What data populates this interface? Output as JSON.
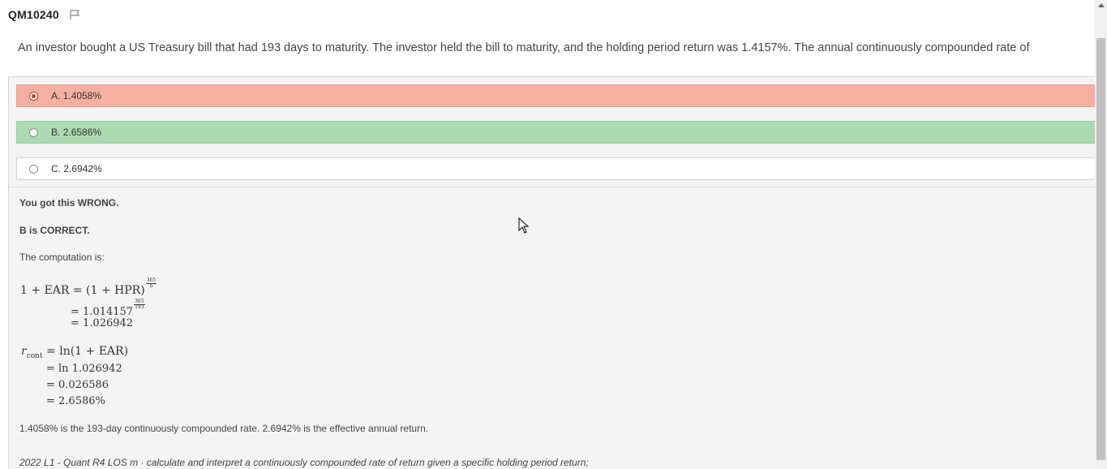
{
  "question_id": "QM10240",
  "question_text": "An investor bought a US Treasury bill that had 193 days to maturity.  The investor held the bill to maturity, and the holding period return was 1.4157%.  The annual continuously compounded rate of",
  "options": [
    {
      "letter": "A.",
      "value": "1.4058%",
      "state": "selected-wrong"
    },
    {
      "letter": "B.",
      "value": "2.6586%",
      "state": "correct"
    },
    {
      "letter": "C.",
      "value": "2.6942%",
      "state": "unselected"
    }
  ],
  "result": "You got this WRONG.",
  "correct_answer": "B is CORRECT.",
  "computation_intro": "The computation is:",
  "math": {
    "line1_lhs": "1 + EAR",
    "line1_rhs": "= (1 + HPR)",
    "line1_exp_num": "365",
    "line1_exp_den": "n",
    "line2": "= 1.014157",
    "line2_exp_num": "365",
    "line2_exp_den": "193",
    "line3": "= 1.026942",
    "r_symbol": "r",
    "r_sub": "cont",
    "r_line1": "= ln(1 + EAR)",
    "r_line2": "= ln 1.026942",
    "r_line3": "= 0.026586",
    "r_line4": "= 2.6586%"
  },
  "note": "1.4058% is the 193-day continuously compounded rate.  2.6942% is the effective annual return.",
  "los": "2022 L1 - Quant R4 LOS m  · calculate and interpret a continuously compounded rate of return given a specific holding period return;",
  "colors": {
    "wrong_bg": "#f5b0a1",
    "correct_bg": "#acdab0",
    "panel_bg": "#f4f4f4"
  },
  "icons": [
    "flag-icon",
    "radio-icon",
    "cursor-icon",
    "scroll-up-icon"
  ]
}
